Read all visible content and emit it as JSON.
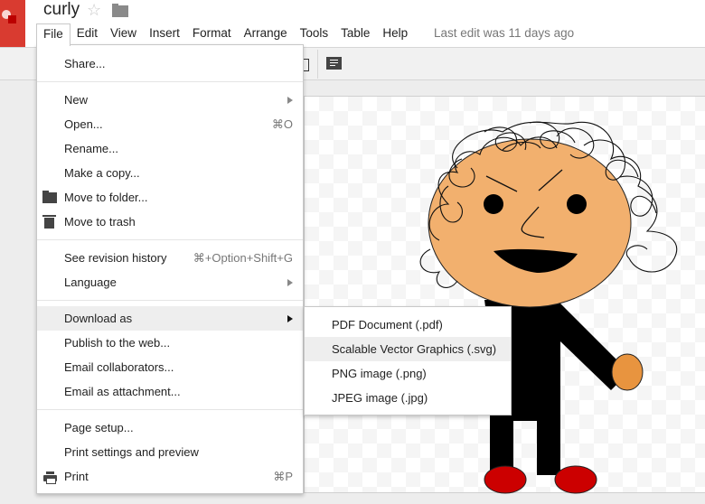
{
  "app": {
    "doc_title": "curly",
    "last_edit": "Last edit was 11 days ago"
  },
  "menubar": {
    "items": [
      "File",
      "Edit",
      "View",
      "Insert",
      "Format",
      "Arrange",
      "Tools",
      "Table",
      "Help"
    ],
    "open_menu": "File"
  },
  "file_menu": {
    "share": "Share...",
    "new": "New",
    "open": "Open...",
    "open_shortcut": "⌘O",
    "rename": "Rename...",
    "make_copy": "Make a copy...",
    "move_to_folder": "Move to folder...",
    "move_to_trash": "Move to trash",
    "see_revision_history": "See revision history",
    "revision_shortcut": "⌘+Option+Shift+G",
    "language": "Language",
    "download_as": "Download as",
    "publish": "Publish to the web...",
    "email_collaborators": "Email collaborators...",
    "email_attachment": "Email as attachment...",
    "page_setup": "Page setup...",
    "print_settings": "Print settings and preview",
    "print": "Print",
    "print_shortcut": "⌘P"
  },
  "download_submenu": {
    "items": [
      "PDF Document (.pdf)",
      "Scalable Vector Graphics (.svg)",
      "PNG image (.png)",
      "JPEG image (.jpg)"
    ],
    "highlighted": "Scalable Vector Graphics (.svg)"
  },
  "colors": {
    "brand_red": "#d93b30",
    "face": "#f2b06e",
    "hand": "#e8943f",
    "shoes": "#cc0000",
    "menu_highlight": "#eeeeee"
  }
}
